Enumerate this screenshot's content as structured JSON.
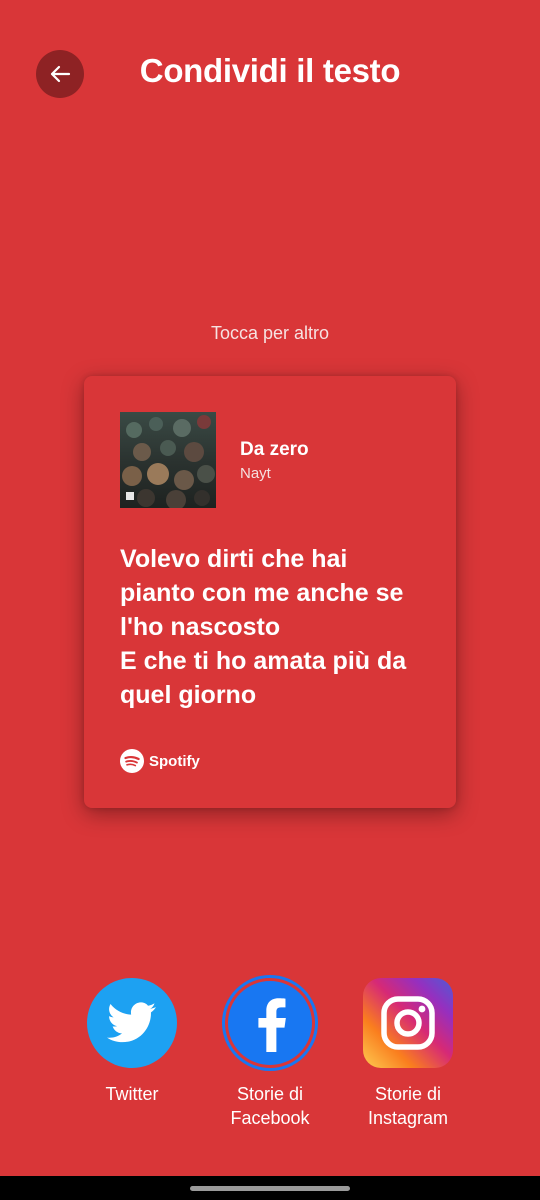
{
  "header": {
    "title": "Condividi il testo"
  },
  "hint": "Tocca per altro",
  "card": {
    "song_title": "Da zero",
    "artist": "Nayt",
    "lyrics": "Volevo dirti che hai\npianto con me anche se\nl'ho nascosto\nE che ti ho amata più da\nquel giorno",
    "brand": "Spotify",
    "background_color": "#D93638"
  },
  "share_options": [
    {
      "label": "Twitter",
      "icon": "twitter-icon",
      "color": "#1DA1F2"
    },
    {
      "label": "Storie di\nFacebook",
      "icon": "facebook-icon",
      "color": "#1877F2"
    },
    {
      "label": "Storie di\nInstagram",
      "icon": "instagram-icon",
      "color": "#C13584"
    }
  ],
  "colors": {
    "background": "#D93638",
    "back_button": "#8E2224"
  }
}
